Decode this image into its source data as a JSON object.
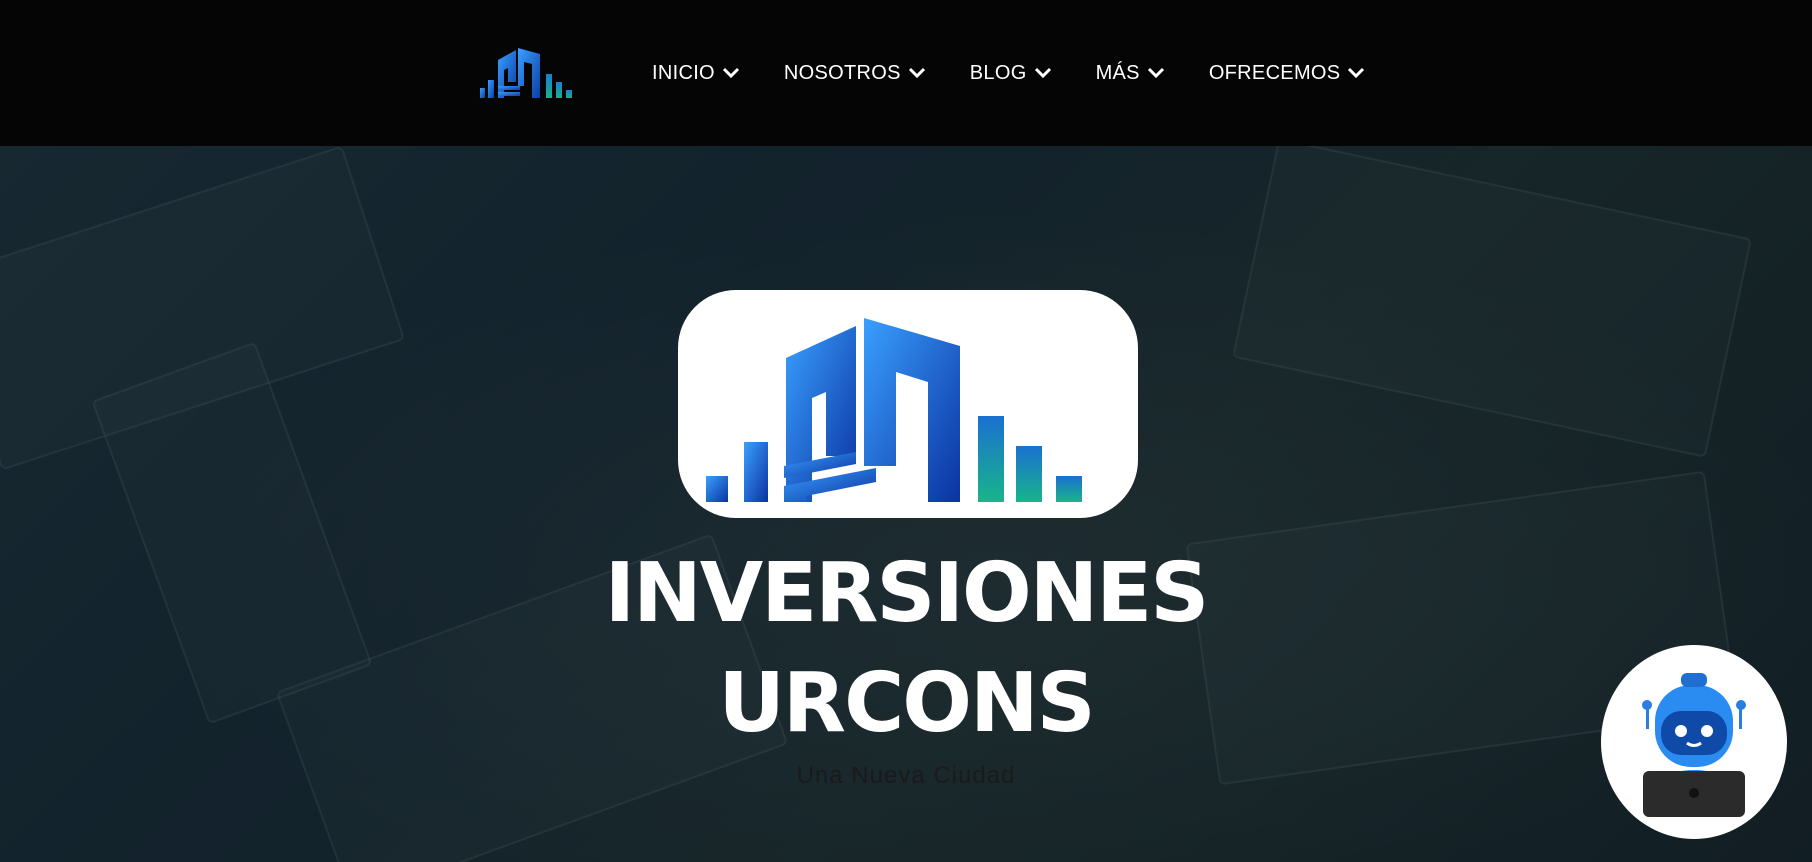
{
  "nav": {
    "items": [
      {
        "label": "INICIO"
      },
      {
        "label": "NOSOTROS"
      },
      {
        "label": "BLOG"
      },
      {
        "label": "MÁS"
      },
      {
        "label": "OFRECEMOS"
      }
    ]
  },
  "hero": {
    "title_line1": "INVERSIONES",
    "title_line2": "URCONS",
    "subtitle": "Una Nueva Ciudad"
  },
  "colors": {
    "logo_blue": "#1a5fd0",
    "logo_teal": "#19a88a",
    "topbar": "#050505"
  },
  "icons": [
    "logo-icon",
    "chevron-down-icon",
    "chatbot-robot-icon"
  ]
}
